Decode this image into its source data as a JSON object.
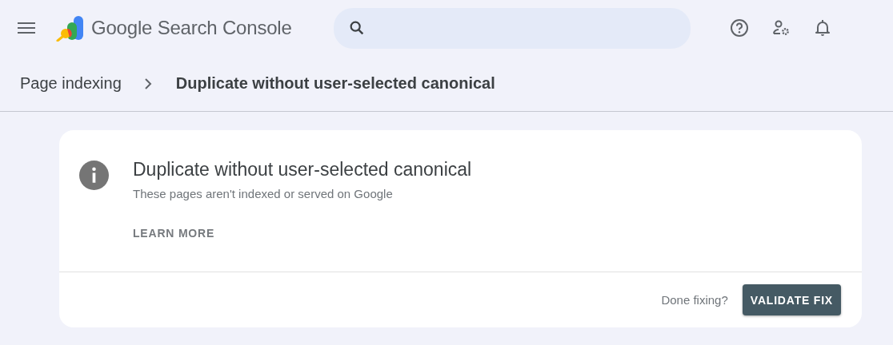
{
  "header": {
    "product_name": "Google Search Console"
  },
  "breadcrumb": [
    {
      "label": "Page indexing",
      "current": false
    },
    {
      "label": "Duplicate without user-selected canonical",
      "current": true
    }
  ],
  "card": {
    "title": "Duplicate without user-selected canonical",
    "subtitle": "These pages aren't indexed or served on Google",
    "link": "LEARN MORE",
    "footer_text": "Done fixing?",
    "button": "VALIDATE FIX"
  }
}
